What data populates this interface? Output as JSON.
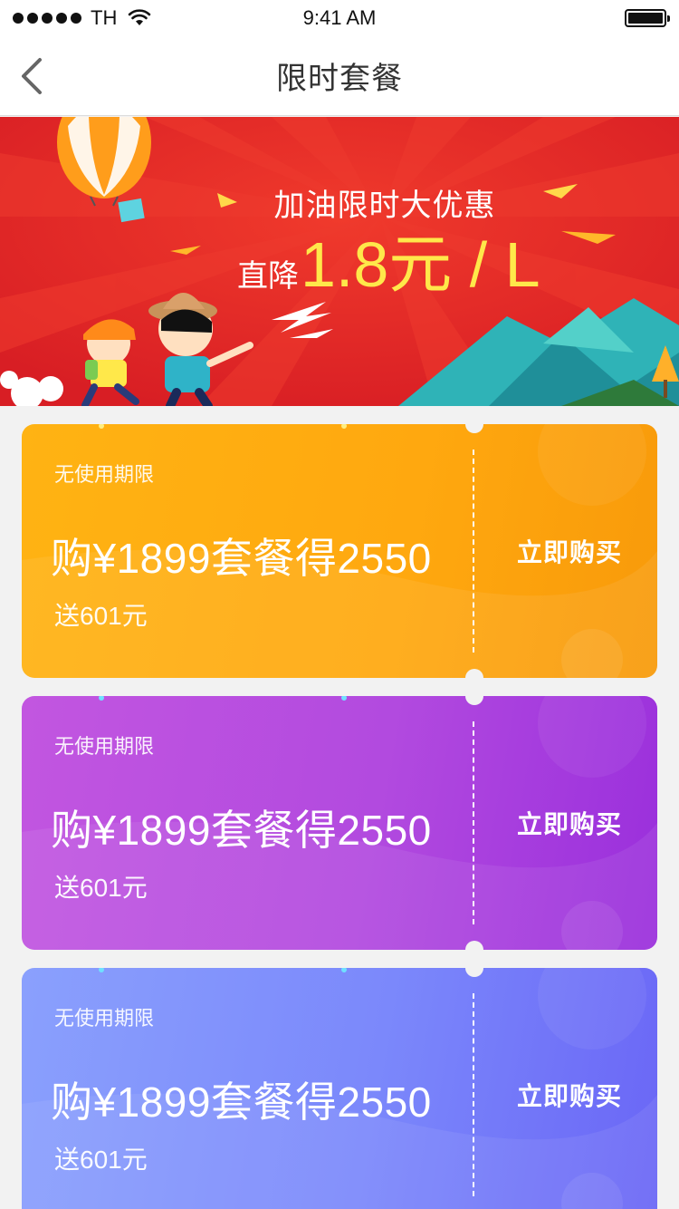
{
  "status_bar": {
    "carrier": "TH",
    "time": "9:41 AM"
  },
  "nav": {
    "title": "限时套餐",
    "back_icon": "chevron-left-icon"
  },
  "banner": {
    "headline": "加油限时大优惠",
    "price_prefix": "直降",
    "price_value": "1.8元 / L",
    "colors": {
      "background": "#e52a26",
      "highlight": "#ffe84a"
    }
  },
  "coupons": [
    {
      "validity": "无使用期限",
      "title": "购¥1899套餐得2550",
      "bonus": "送601元",
      "action": "立即购买",
      "color": "#ffab10"
    },
    {
      "validity": "无使用期限",
      "title": "购¥1899套餐得2550",
      "bonus": "送601元",
      "action": "立即购买",
      "color": "#b24adf"
    },
    {
      "validity": "无使用期限",
      "title": "购¥1899套餐得2550",
      "bonus": "送601元",
      "action": "立即购买",
      "color": "#7b88fb"
    }
  ]
}
